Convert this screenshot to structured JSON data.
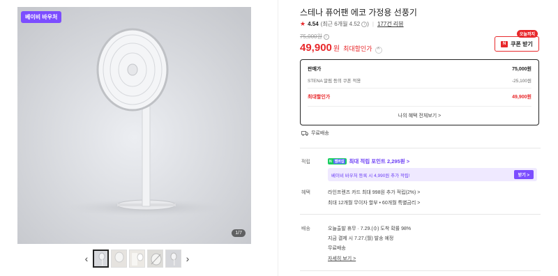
{
  "gallery": {
    "store_badge": "베이비 바우처",
    "counter": "1/7",
    "prev_arrow": "‹",
    "next_arrow": "›",
    "thumbnail_count": 5
  },
  "product": {
    "title": "스테나 퓨어팬 에코 가정용 선풍기",
    "rating": {
      "score": "4.54",
      "recent": "(최근 6개월 4.52",
      "recent_close": ")",
      "reviews": "177건 리뷰"
    },
    "original_price": "75,000원",
    "price": "49,900",
    "price_unit": "원",
    "price_label": "최대할인가"
  },
  "coupon": {
    "today_badge": "오늘까지",
    "button_label": "쿠폰 받기",
    "brand_mark": "N"
  },
  "price_breakdown": {
    "rows": [
      {
        "label": "판매가",
        "value": "75,000원"
      },
      {
        "label": "STENA 알림 등의 쿠폰 적용",
        "value": "-25,100원"
      },
      {
        "label": "최대할인가",
        "value": "49,900원"
      }
    ],
    "view_all": "나의 혜택 전체보기 >"
  },
  "shipping_tag": "무료배송",
  "points": {
    "label": "적립",
    "npay": "N",
    "npay_plus": "멤버십",
    "max_points": "최대 적립 포인트 2,295원 >",
    "voucher_text": "베이비 바우처 등록 시 4,990원 추가 적립!",
    "voucher_btn": "받기 >"
  },
  "benefits": {
    "label": "혜택",
    "line1": "라인프렌즈 카드 최대 998원 추가 적립(2%) >",
    "line2": "최대 12개월 무이자 할부 • 60개월 특별금리 >"
  },
  "delivery": {
    "label": "배송",
    "line1": "오늘출발 휴무 · 7.29.(수) 도착 확률 98%",
    "line2": "지금 결제 시 7.27.(월) 발송 예정",
    "line3": "무료배송",
    "detail_link": "자세히 보기 >"
  },
  "colors": {
    "accent_red": "#e8282b",
    "accent_purple": "#7c4dff",
    "npay_green": "#19ce60"
  }
}
